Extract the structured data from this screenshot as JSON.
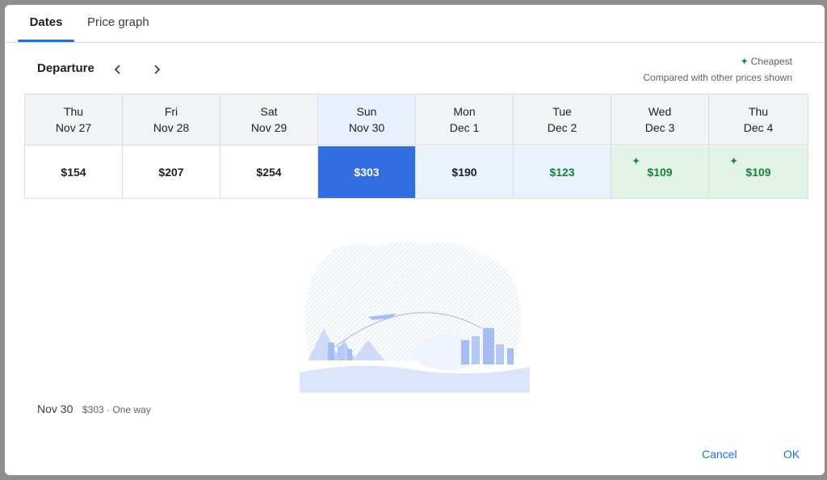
{
  "tabs": [
    {
      "label": "Dates"
    },
    {
      "label": "Price graph"
    }
  ],
  "departure_label": "Departure",
  "legend": {
    "cheapest": "Cheapest",
    "note": "Compared with other prices shown",
    "spark": "✦"
  },
  "days": [
    {
      "dow": "Thu",
      "date": "Nov 27",
      "price": "$154"
    },
    {
      "dow": "Fri",
      "date": "Nov 28",
      "price": "$207"
    },
    {
      "dow": "Sat",
      "date": "Nov 29",
      "price": "$254"
    },
    {
      "dow": "Sun",
      "date": "Nov 30",
      "price": "$303"
    },
    {
      "dow": "Mon",
      "date": "Dec 1",
      "price": "$190"
    },
    {
      "dow": "Tue",
      "date": "Dec 2",
      "price": "$123"
    },
    {
      "dow": "Wed",
      "date": "Dec 3",
      "price": "$109"
    },
    {
      "dow": "Thu",
      "date": "Dec 4",
      "price": "$109"
    }
  ],
  "footer": {
    "date": "Nov 30",
    "summary": "$303 · One way"
  },
  "buttons": {
    "cancel": "Cancel",
    "ok": "OK"
  },
  "colors": {
    "accent": "#1a73e8",
    "selected": "#326ee0",
    "green": "#188038"
  }
}
